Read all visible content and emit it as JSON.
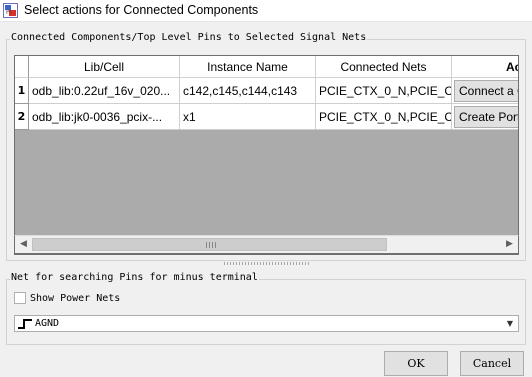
{
  "window": {
    "title": "Select actions for Connected Components"
  },
  "group_pins": {
    "legend": "Connected Components/Top Level Pins to Selected Signal Nets"
  },
  "table": {
    "columns": [
      "Lib/Cell",
      "Instance Name",
      "Connected Nets",
      "Actio"
    ],
    "rows": [
      {
        "num": "1",
        "lib": "odb_lib:0.22uf_16v_020...",
        "inst": "c142,c145,c144,c143",
        "nets": "PCIE_CTX_0_N,PCIE_CT...",
        "action": "Connect a Comp"
      },
      {
        "num": "2",
        "lib": "odb_lib:jk0-0036_pcix-...",
        "inst": "x1",
        "nets": "PCIE_CTX_0_N,PCIE_CT...",
        "action": "Create Ports"
      }
    ]
  },
  "scroll": {
    "left_icon": "scroll-left-icon",
    "right_icon": "scroll-right-icon"
  },
  "group_net": {
    "legend": "Net for searching Pins for minus terminal"
  },
  "show_power_nets": {
    "label": "Show Power Nets",
    "checked": false
  },
  "net_combo": {
    "value": "AGND",
    "icon": "net-icon"
  },
  "buttons": {
    "ok": "OK",
    "cancel": "Cancel"
  }
}
